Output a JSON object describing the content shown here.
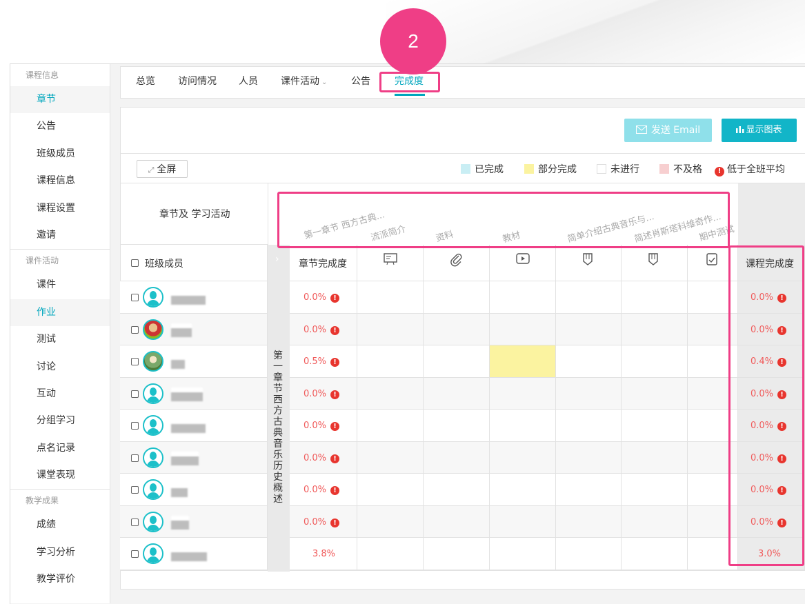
{
  "step_badge": "2",
  "sidebar": {
    "groups": [
      {
        "title": "课程信息",
        "items": [
          "章节",
          "公告",
          "班级成员",
          "课程信息",
          "课程设置",
          "邀请"
        ]
      },
      {
        "title": "课件活动",
        "items": [
          "课件",
          "作业",
          "测试",
          "讨论",
          "互动",
          "分组学习",
          "点名记录",
          "课堂表现"
        ]
      },
      {
        "title": "教学成果",
        "items": [
          "成绩",
          "学习分析",
          "教学评价"
        ]
      }
    ],
    "active_items": [
      "章节",
      "作业"
    ]
  },
  "tabs": [
    {
      "label": "总览"
    },
    {
      "label": "访问情况"
    },
    {
      "label": "人员"
    },
    {
      "label": "课件活动",
      "has_dropdown": true
    },
    {
      "label": "公告"
    },
    {
      "label": "完成度",
      "active": true
    }
  ],
  "toolbar": {
    "send_email": "发送 Email",
    "show_chart": "显示图表",
    "fullscreen": "全屏"
  },
  "legend": {
    "completed": "已完成",
    "partial": "部分完成",
    "not_started": "未进行",
    "failed": "不及格",
    "below_avg": "低于全班平均"
  },
  "colors": {
    "accent": "#00a6bd",
    "highlight": "#ef3e86",
    "partial": "#fbf3a0",
    "completed": "#c9eef4",
    "failed": "#f7cfd0",
    "warn": "#e8352e"
  },
  "table": {
    "header_left": "章节及 学习活动",
    "member_header": "班级成员",
    "chapter_completion_header": "章节完成度",
    "course_completion_header": "课程完成度",
    "chapter_name": "第一章节 西方古典音乐历史概述",
    "activities": [
      {
        "title": "第一章节 西方古典...",
        "icon": ""
      },
      {
        "title": "流派简介",
        "icon": "presentation-icon"
      },
      {
        "title": "资料",
        "icon": "paperclip-icon"
      },
      {
        "title": "教材",
        "icon": "video-play-icon"
      },
      {
        "title": "简单介绍古典音乐与...",
        "icon": "assignment-icon"
      },
      {
        "title": "简述肖斯塔科维奇作...",
        "icon": "assignment-icon"
      },
      {
        "title": "期中测试",
        "icon": "quiz-icon"
      }
    ],
    "rows": [
      {
        "chapter": "0.0%",
        "course": "0.0%",
        "below_avg": true,
        "partial_col": -1
      },
      {
        "chapter": "0.0%",
        "course": "0.0%",
        "below_avg": true,
        "partial_col": -1
      },
      {
        "chapter": "0.5%",
        "course": "0.4%",
        "below_avg": true,
        "partial_col": 2
      },
      {
        "chapter": "0.0%",
        "course": "0.0%",
        "below_avg": true,
        "partial_col": -1
      },
      {
        "chapter": "0.0%",
        "course": "0.0%",
        "below_avg": true,
        "partial_col": -1
      },
      {
        "chapter": "0.0%",
        "course": "0.0%",
        "below_avg": true,
        "partial_col": -1
      },
      {
        "chapter": "0.0%",
        "course": "0.0%",
        "below_avg": true,
        "partial_col": -1
      },
      {
        "chapter": "0.0%",
        "course": "0.0%",
        "below_avg": true,
        "partial_col": -1
      }
    ],
    "average_row": {
      "chapter": "3.8%",
      "course": "3.0%"
    }
  }
}
